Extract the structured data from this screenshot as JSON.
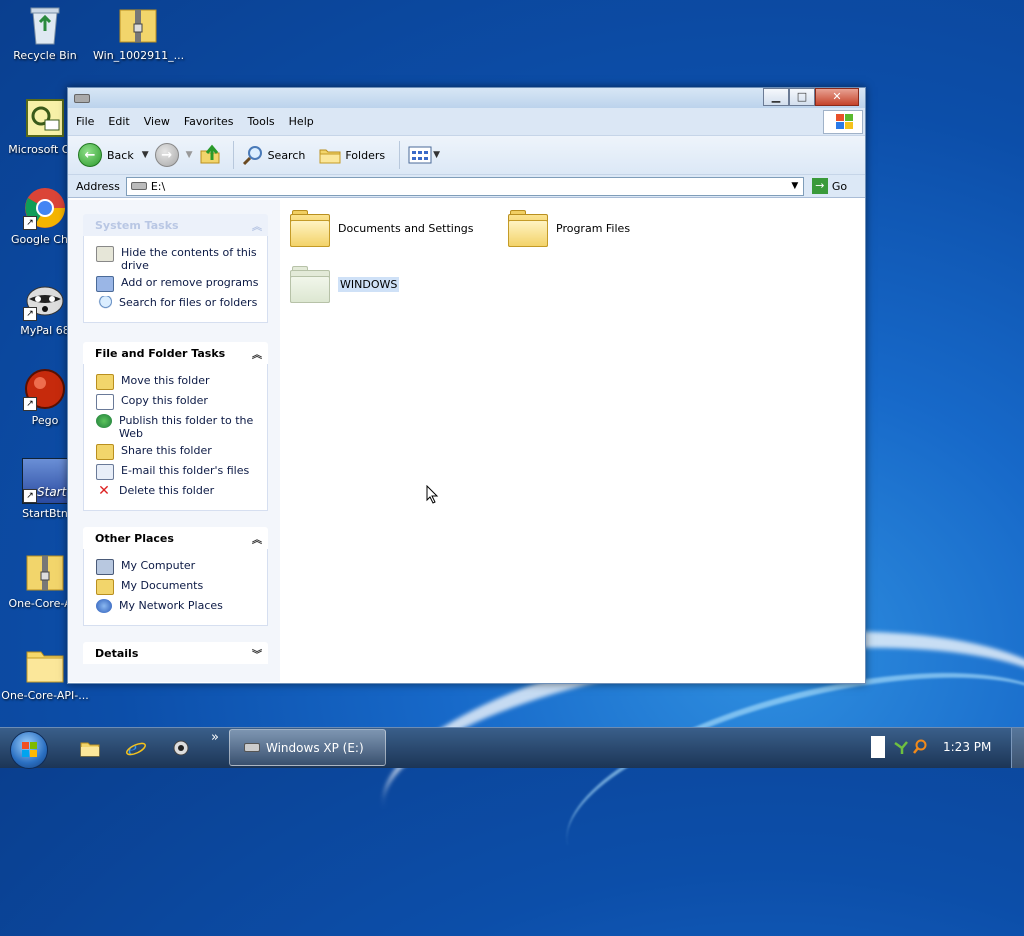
{
  "desktop": {
    "icons": [
      {
        "label": "Recycle Bin"
      },
      {
        "label": "Win_1002911_..."
      },
      {
        "label": "Microsoft Out"
      },
      {
        "label": "Google Chro"
      },
      {
        "label": "MyPal 68"
      },
      {
        "label": "Pego"
      },
      {
        "label": "StartBtn"
      },
      {
        "label": "One-Core-API"
      },
      {
        "label": "One-Core-API-..."
      }
    ],
    "startbtn_overlay_text": "Start"
  },
  "window": {
    "controls": {
      "minimize": "▁",
      "maximize": "□",
      "close": "✕"
    },
    "menu": [
      "File",
      "Edit",
      "View",
      "Favorites",
      "Tools",
      "Help"
    ],
    "toolbar": {
      "back_label": "Back",
      "search_label": "Search",
      "folders_label": "Folders"
    },
    "address": {
      "label": "Address",
      "value": "E:\\",
      "go_label": "Go"
    },
    "panels": {
      "system_tasks": {
        "title": "System Tasks",
        "items": [
          "Hide the contents of this drive",
          "Add or remove programs",
          "Search for files or folders"
        ]
      },
      "file_folder_tasks": {
        "title": "File and Folder Tasks",
        "items": [
          "Move this folder",
          "Copy this folder",
          "Publish this folder to the Web",
          "Share this folder",
          "E-mail this folder's files",
          "Delete this folder"
        ]
      },
      "other_places": {
        "title": "Other Places",
        "items": [
          "My Computer",
          "My Documents",
          "My Network Places"
        ]
      },
      "details": {
        "title": "Details"
      }
    },
    "folders": [
      {
        "name": "Documents and Settings"
      },
      {
        "name": "Program Files"
      },
      {
        "name": "WINDOWS"
      }
    ]
  },
  "taskbar": {
    "active_task": "Windows XP (E:)",
    "quick_more": "»",
    "clock": "1:23 PM"
  }
}
